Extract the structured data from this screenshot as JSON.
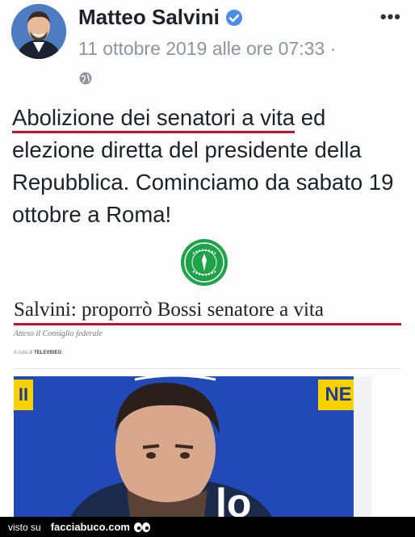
{
  "post": {
    "author": "Matteo Salvini",
    "timestamp": "11 ottobre 2019 alle ore 07:33 ·",
    "more_menu": "•••",
    "text_underlined": "Abolizione dei senatori a vita",
    "text_rest": " ed elezione diretta del presidente della Repubblica. Cominciamo da sabato 19 ottobre a Roma!"
  },
  "article": {
    "headline": "Salvini: proporrò Bossi senatore a vita",
    "subhead": "Atteso il Consiglio federale",
    "credit_prefix": "A cura di ",
    "credit_source": "TELEVIDEO",
    "photo_label_left": "II",
    "photo_label_right": "NE",
    "photo_big_text": "lo"
  },
  "footer": {
    "prefix": "visto su",
    "brand": "facciabuco.com"
  },
  "colors": {
    "underline": "#c8102e",
    "logo_green": "#1fa34a",
    "stage_blue": "#2149b8",
    "stage_yellow": "#f7d200"
  }
}
